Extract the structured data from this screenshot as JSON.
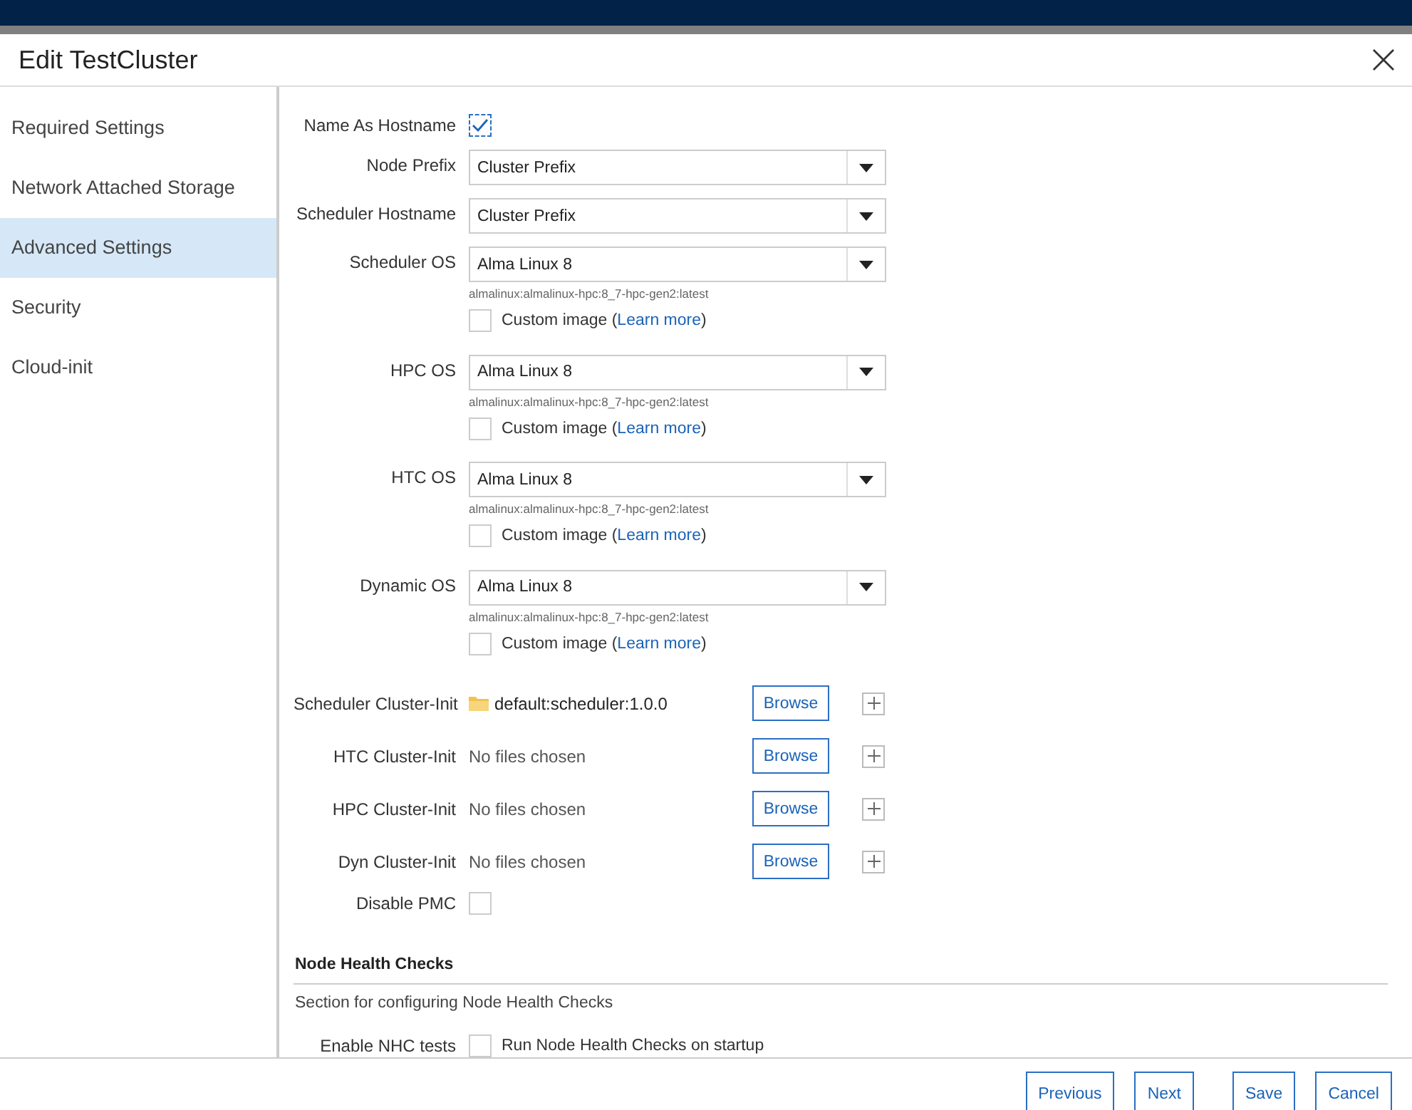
{
  "window": {
    "title": "Edit TestCluster"
  },
  "sidebar": {
    "items": [
      {
        "label": "Required Settings",
        "selected": false
      },
      {
        "label": "Network Attached Storage",
        "selected": false
      },
      {
        "label": "Advanced Settings",
        "selected": true
      },
      {
        "label": "Security",
        "selected": false
      },
      {
        "label": "Cloud-init",
        "selected": false
      }
    ]
  },
  "fields": [
    {
      "kind": "checkbox",
      "label": "Name As Hostname",
      "checked": true
    },
    {
      "kind": "select",
      "label": "Node Prefix",
      "value": "Cluster Prefix"
    },
    {
      "kind": "select",
      "label": "Scheduler Hostname",
      "value": "Cluster Prefix"
    },
    {
      "kind": "os",
      "label": "Scheduler OS",
      "value": "Alma Linux 8",
      "hint": "almalinux:almalinux-hpc:8_7-hpc-gen2:latest",
      "custom_label": "Custom image (",
      "link": "Learn more",
      "close": ")",
      "checked": false
    },
    {
      "kind": "os",
      "label": "HPC OS",
      "value": "Alma Linux 8",
      "hint": "almalinux:almalinux-hpc:8_7-hpc-gen2:latest",
      "custom_label": "Custom image (",
      "link": "Learn more",
      "close": ")",
      "checked": false
    },
    {
      "kind": "os",
      "label": "HTC OS",
      "value": "Alma Linux 8",
      "hint": "almalinux:almalinux-hpc:8_7-hpc-gen2:latest",
      "custom_label": "Custom image (",
      "link": "Learn more",
      "close": ")",
      "checked": false
    },
    {
      "kind": "os",
      "label": "Dynamic OS",
      "value": "Alma Linux 8",
      "hint": "almalinux:almalinux-hpc:8_7-hpc-gen2:latest",
      "custom_label": "Custom image (",
      "link": "Learn more",
      "close": ")",
      "checked": false
    },
    {
      "kind": "files",
      "label": "Scheduler Cluster-Init",
      "value": "default:scheduler:1.0.0",
      "has_file": true,
      "button": "Browse"
    },
    {
      "kind": "files",
      "label": "HTC Cluster-Init",
      "value": "No files chosen",
      "has_file": false,
      "button": "Browse"
    },
    {
      "kind": "files",
      "label": "HPC Cluster-Init",
      "value": "No files chosen",
      "has_file": false,
      "button": "Browse"
    },
    {
      "kind": "files",
      "label": "Dyn Cluster-Init",
      "value": "No files chosen",
      "has_file": false,
      "button": "Browse"
    },
    {
      "kind": "checkbox",
      "label": "Disable PMC",
      "checked": false
    }
  ],
  "section": {
    "title": "Node Health Checks",
    "description": "Section for configuring Node Health Checks",
    "fields": [
      {
        "kind": "checkbox",
        "label": "Enable NHC tests",
        "text": "Run Node Health Checks on startup",
        "checked": false
      }
    ]
  },
  "footer": {
    "buttons": [
      "Previous",
      "Next",
      "Save",
      "Cancel"
    ]
  }
}
